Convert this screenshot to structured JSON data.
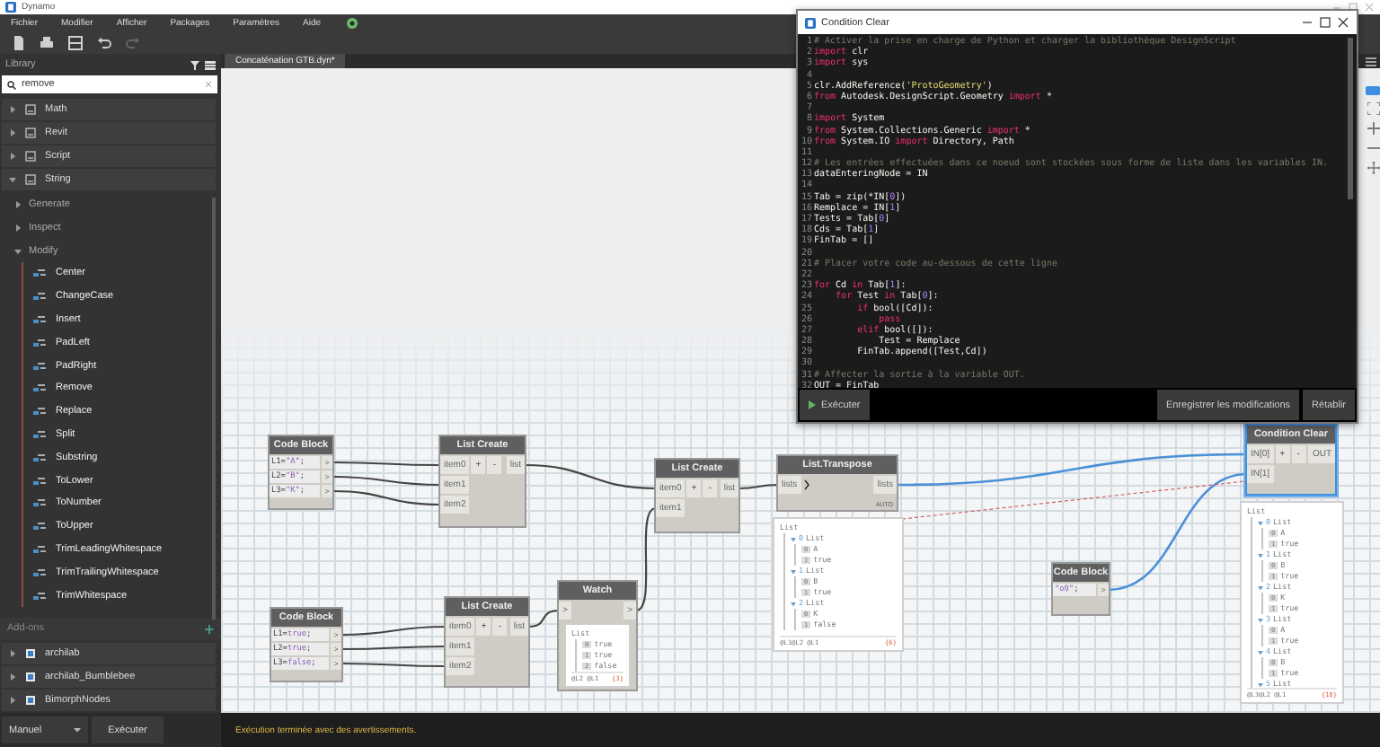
{
  "window": {
    "title": "Dynamo"
  },
  "menu": [
    "Fichier",
    "Modifier",
    "Afficher",
    "Packages",
    "Paramètres",
    "Aide"
  ],
  "library": {
    "title": "Library",
    "search": {
      "value": "remove"
    },
    "categories": [
      {
        "label": "Math",
        "expanded": false
      },
      {
        "label": "Revit",
        "expanded": false
      },
      {
        "label": "Script",
        "expanded": false
      },
      {
        "label": "String",
        "expanded": true,
        "children": [
          {
            "label": "Generate",
            "expanded": false
          },
          {
            "label": "Inspect",
            "expanded": false
          },
          {
            "label": "Modify",
            "expanded": true,
            "children": [
              {
                "label": "Center"
              },
              {
                "label": "ChangeCase"
              },
              {
                "label": "Insert"
              },
              {
                "label": "PadLeft"
              },
              {
                "label": "PadRight"
              },
              {
                "label": "Remove"
              },
              {
                "label": "Replace"
              },
              {
                "label": "Split"
              },
              {
                "label": "Substring"
              },
              {
                "label": "ToLower"
              },
              {
                "label": "ToNumber"
              },
              {
                "label": "ToUpper"
              },
              {
                "label": "TrimLeadingWhitespace"
              },
              {
                "label": "TrimTrailingWhitespace"
              },
              {
                "label": "TrimWhitespace"
              }
            ]
          }
        ]
      }
    ],
    "addons": {
      "title": "Add-ons",
      "items": [
        {
          "label": "archilab",
          "expanded": false
        },
        {
          "label": "archilab_Bumblebee",
          "expanded": false
        },
        {
          "label": "BimorphNodes",
          "expanded": false
        }
      ]
    }
  },
  "tabs": [
    {
      "label": "Concaténation GTB.dyn*",
      "selected": true
    }
  ],
  "nodes": [
    {
      "kind": "code_block",
      "title": "Code Block",
      "selected": false,
      "lines": [
        {
          "code": "L1=\"A\";",
          "port": ">"
        },
        {
          "code": "L2=\"B\";",
          "port": ">"
        },
        {
          "code": "L3=\"K\";",
          "port": ">"
        }
      ]
    },
    {
      "kind": "list_create",
      "title": "List Create",
      "selected": false,
      "inputs": [
        "item0",
        "item1",
        "item2"
      ],
      "buttons": [
        "+",
        "-"
      ],
      "outputs": [
        "list"
      ]
    },
    {
      "kind": "list_create",
      "title": "List Create",
      "selected": false,
      "inputs": [
        "item0",
        "item1"
      ],
      "buttons": [
        "+",
        "-"
      ],
      "outputs": [
        "list"
      ]
    },
    {
      "kind": "function",
      "title": "List.Transpose",
      "selected": false,
      "inputs": [
        "lists"
      ],
      "outputs": [
        "lists"
      ],
      "lacing": "AUTO",
      "preview": {
        "tree": {
          "label": "List",
          "children": [
            {
              "index": "0",
              "label": "List",
              "children": [
                {
                  "index": "0",
                  "value": "A"
                },
                {
                  "index": "1",
                  "value": "true"
                }
              ]
            },
            {
              "index": "1",
              "label": "List",
              "children": [
                {
                  "index": "0",
                  "value": "B"
                },
                {
                  "index": "1",
                  "value": "true"
                }
              ]
            },
            {
              "index": "2",
              "label": "List",
              "children": [
                {
                  "index": "0",
                  "value": "K"
                },
                {
                  "index": "1",
                  "value": "false"
                }
              ]
            }
          ]
        },
        "levels": "@L3@L2 @L1",
        "count": "{6}"
      }
    },
    {
      "kind": "code_block",
      "title": "Code Block",
      "selected": false,
      "lines": [
        {
          "code": "L1=true;",
          "port": ">"
        },
        {
          "code": "L2=true;",
          "port": ">"
        },
        {
          "code": "L3=false;",
          "port": ">"
        }
      ]
    },
    {
      "kind": "list_create",
      "title": "List Create",
      "selected": false,
      "inputs": [
        "item0",
        "item1",
        "item2"
      ],
      "buttons": [
        "+",
        "-"
      ],
      "outputs": [
        "list"
      ]
    },
    {
      "kind": "watch",
      "title": "Watch",
      "selected": false,
      "inputs": [
        ">"
      ],
      "outputs": [
        ">"
      ],
      "preview": {
        "tree": {
          "label": "List",
          "children": [
            {
              "index": "0",
              "value": "true"
            },
            {
              "index": "1",
              "value": "true"
            },
            {
              "index": "2",
              "value": "false"
            }
          ]
        },
        "levels": "@L2 @L1",
        "count": "{3}"
      }
    },
    {
      "kind": "code_block",
      "title": "Code Block",
      "selected": false,
      "lines": [
        {
          "code": "\"o0\";",
          "port": ">"
        }
      ]
    },
    {
      "kind": "python",
      "title": "Condition Clear",
      "selected": true,
      "inputs": [
        "IN[0]",
        "IN[1]"
      ],
      "buttons": [
        "+",
        "-"
      ],
      "outputs": [
        "OUT"
      ],
      "preview": {
        "tree": {
          "label": "List",
          "children": [
            {
              "index": "0",
              "label": "List",
              "children": [
                {
                  "index": "0",
                  "value": "A"
                },
                {
                  "index": "1",
                  "value": "true"
                }
              ]
            },
            {
              "index": "1",
              "label": "List",
              "children": [
                {
                  "index": "0",
                  "value": "B"
                },
                {
                  "index": "1",
                  "value": "true"
                }
              ]
            },
            {
              "index": "2",
              "label": "List",
              "children": [
                {
                  "index": "0",
                  "value": "K"
                },
                {
                  "index": "1",
                  "value": "true"
                }
              ]
            },
            {
              "index": "3",
              "label": "List",
              "children": [
                {
                  "index": "0",
                  "value": "A"
                },
                {
                  "index": "1",
                  "value": "true"
                }
              ]
            },
            {
              "index": "4",
              "label": "List",
              "children": [
                {
                  "index": "0",
                  "value": "B"
                },
                {
                  "index": "1",
                  "value": "true"
                }
              ]
            },
            {
              "index": "5",
              "label": "List"
            }
          ]
        },
        "levels": "@L3@L2 @L1",
        "count": "{18}"
      }
    }
  ],
  "python_editor": {
    "title": "Condition Clear",
    "lines": [
      {
        "n": "1",
        "text": "# Activer la prise en charge de Python et charger la bibliothèque DesignScript"
      },
      {
        "n": "2",
        "text": "import clr"
      },
      {
        "n": "3",
        "text": "import sys"
      },
      {
        "n": "4"
      },
      {
        "n": "5",
        "text": "clr.AddReference('ProtoGeometry')"
      },
      {
        "n": "6",
        "text": "from Autodesk.DesignScript.Geometry import *"
      },
      {
        "n": "7"
      },
      {
        "n": "8",
        "text": "import System"
      },
      {
        "n": "9",
        "text": "from System.Collections.Generic import *"
      },
      {
        "n": "10",
        "text": "from System.IO import Directory, Path"
      },
      {
        "n": "11"
      },
      {
        "n": "12",
        "text": "# Les entrées effectuées dans ce noeud sont stockées sous forme de liste dans les variables IN."
      },
      {
        "n": "13",
        "text": "dataEnteringNode = IN"
      },
      {
        "n": "14"
      },
      {
        "n": "15",
        "text": "Tab = zip(*IN[0])"
      },
      {
        "n": "16",
        "text": "Remplace = IN[1]"
      },
      {
        "n": "17",
        "text": "Tests = Tab[0]"
      },
      {
        "n": "18",
        "text": "Cds = Tab[1]"
      },
      {
        "n": "19",
        "text": "FinTab = []"
      },
      {
        "n": "20"
      },
      {
        "n": "21",
        "text": "# Placer votre code au-dessous de cette ligne"
      },
      {
        "n": "22"
      },
      {
        "n": "23",
        "text": "for Cd in Tab[1]:"
      },
      {
        "n": "24",
        "text": "    for Test in Tab[0]:"
      },
      {
        "n": "25",
        "text": "        if bool([Cd]):"
      },
      {
        "n": "26",
        "text": "            pass"
      },
      {
        "n": "27",
        "text": "        elif bool([]):"
      },
      {
        "n": "28",
        "text": "            Test = Remplace"
      },
      {
        "n": "29",
        "text": "        FinTab.append([Test,Cd])"
      },
      {
        "n": "30"
      },
      {
        "n": "31",
        "text": "# Affecter la sortie à la variable OUT."
      },
      {
        "n": "32",
        "text": "OUT = FinTab"
      }
    ],
    "run_button": "Exécuter",
    "save_button": "Enregistrer les modifications",
    "revert_button": "Rétablir"
  },
  "run_bar": {
    "mode": "Manuel",
    "button": "Exécuter",
    "status": "Exécution terminée avec des avertissements."
  }
}
